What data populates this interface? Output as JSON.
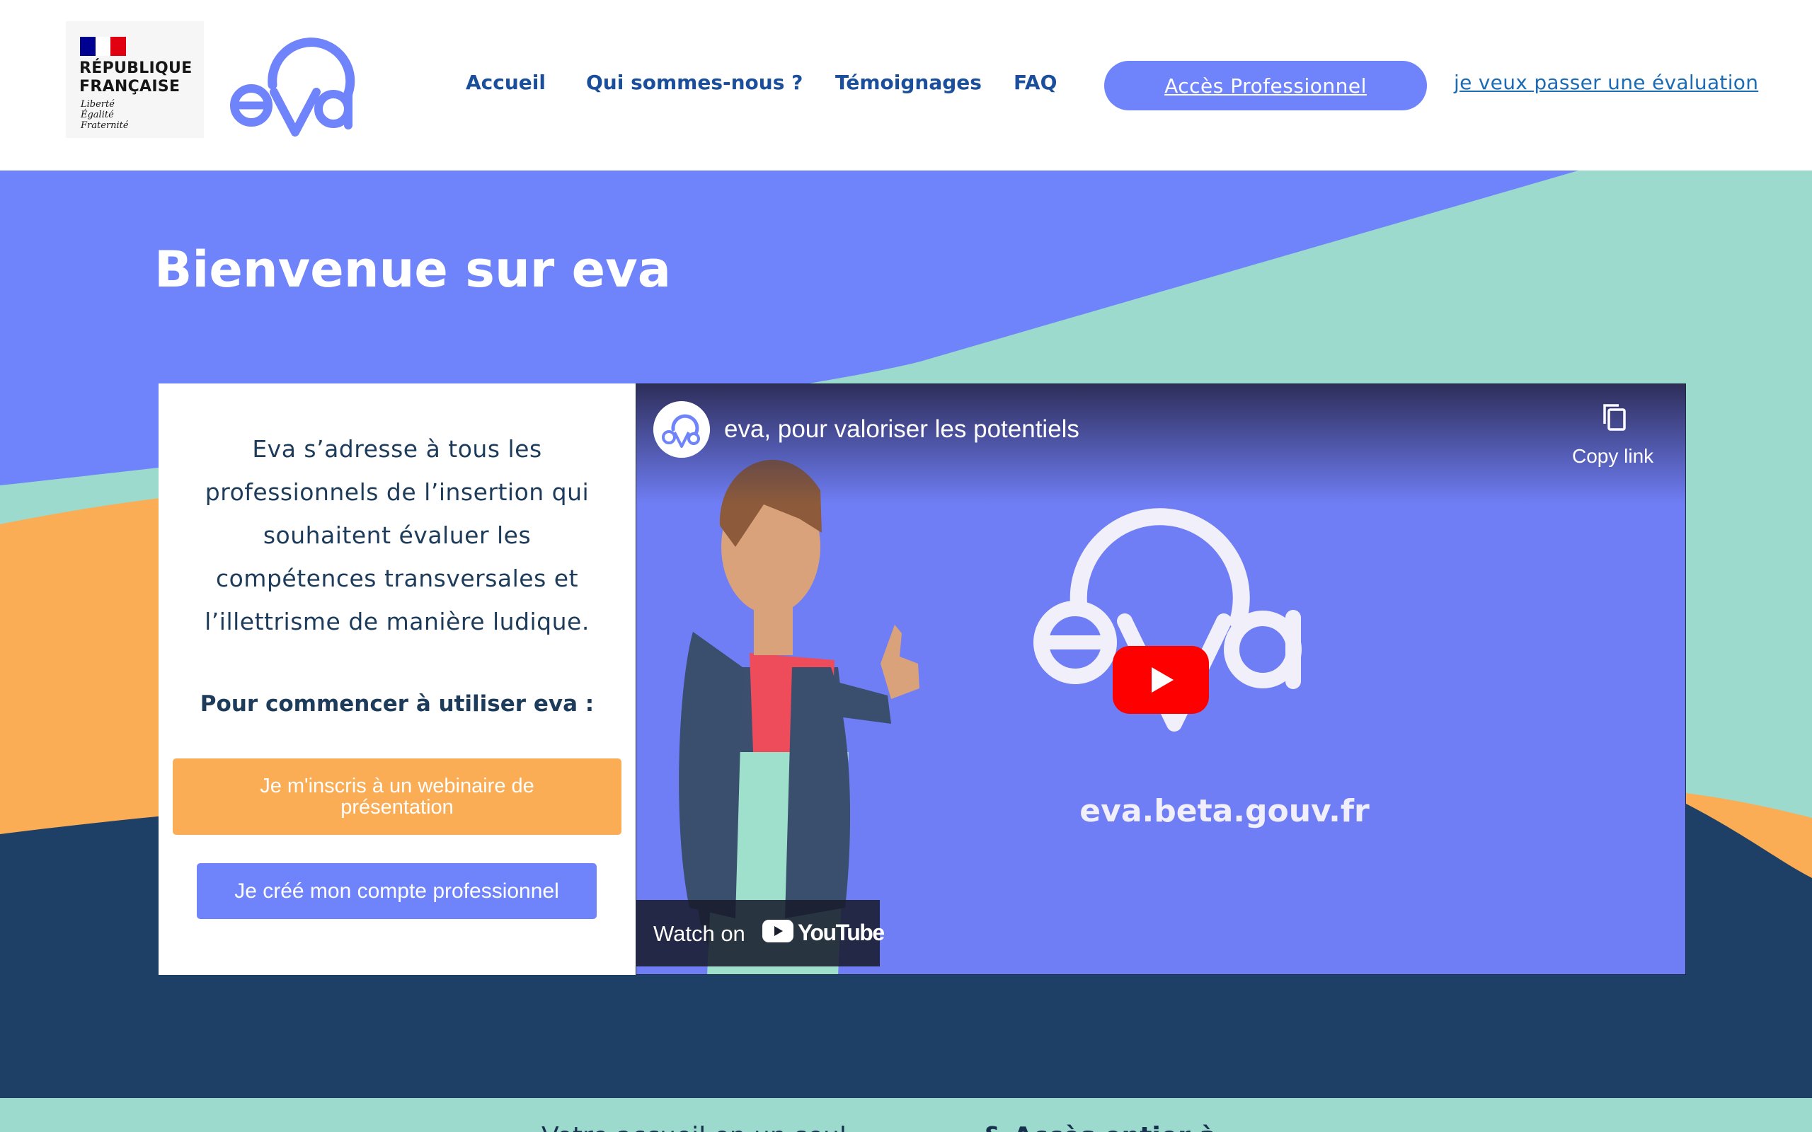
{
  "header": {
    "republique_lines": [
      "RÉPUBLIQUE",
      "FRANÇAISE"
    ],
    "republique_motto": [
      "Liberté",
      "Égalité",
      "Fraternité"
    ],
    "logo_text": "eva",
    "nav": [
      "Accueil",
      "Qui sommes-nous ?",
      "Témoignages",
      "FAQ"
    ],
    "pro_button": "Accès Professionnel",
    "eval_link": "je veux passer une évaluation"
  },
  "hero": {
    "title": "Bienvenue sur eva",
    "description_lines": [
      "Eva s’adresse à tous les",
      "professionnels de l’insertion qui",
      "souhaitent évaluer les",
      "compétences transversales et",
      "l’illettrisme de manière ludique."
    ],
    "start_label": "Pour commencer à utiliser eva  :",
    "webinar_button": "Je m'inscris à un webinaire de présentation",
    "account_button": "Je créé mon compte professionnel"
  },
  "video": {
    "title": "eva, pour valoriser les potentiels",
    "copy_link": "Copy link",
    "url_text": "eva.beta.gouv.fr",
    "watch_on": "Watch on",
    "youtube": "YouTube",
    "icons": [
      "eva-channel-avatar",
      "copy-icon",
      "play-icon",
      "youtube-logo-icon"
    ]
  },
  "footer": {
    "text_regular": "Votre accueil en un seul",
    "text_bold": "& Accès entier à"
  },
  "colors": {
    "blue_accent": "#6f83fa",
    "navy": "#1e3f66",
    "mint": "#9bdacd",
    "orange": "#fbad55",
    "nav_text": "#1b4f9c"
  }
}
